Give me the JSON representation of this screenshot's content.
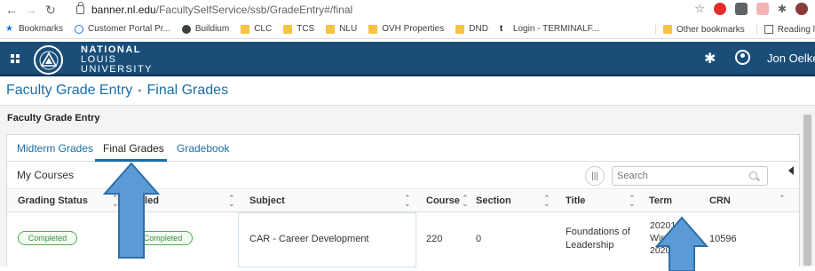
{
  "browser": {
    "url_host": "banner.nl.edu",
    "url_path": "/FacultySelfService/ssb/GradeEntry#/final",
    "bookmarks": [
      "Bookmarks",
      "Customer Portal Pr...",
      "Buildium",
      "CLC",
      "TCS",
      "NLU",
      "OVH Properties",
      "DND",
      "Login - TERMINALF..."
    ],
    "bookmarks_right": [
      "Other bookmarks",
      "Reading l"
    ]
  },
  "header": {
    "logo_line1": "NATIONAL",
    "logo_line2": "LOUIS",
    "logo_line3": "UNIVERSITY",
    "user_name": "Jon Oelke"
  },
  "breadcrumb": {
    "parent": "Faculty Grade Entry",
    "separator": "•",
    "current": "Final Grades"
  },
  "page": {
    "section_title": "Faculty Grade Entry",
    "tabs": [
      {
        "label": "Midterm Grades",
        "active": false
      },
      {
        "label": "Final Grades",
        "active": true
      },
      {
        "label": "Gradebook",
        "active": false
      }
    ],
    "courses_label": "My Courses",
    "search_placeholder": "Search"
  },
  "table": {
    "columns": [
      "Grading Status",
      "lled",
      "Subject",
      "Course",
      "Section",
      "Title",
      "Term",
      "CRN"
    ],
    "rows": [
      {
        "grading_status": "Completed",
        "rolled": "Completed",
        "subject": "CAR - Career Development",
        "course": "220",
        "section": "0",
        "title_line1": "Foundations of",
        "title_line2": "Leadership",
        "term_line1": "202010",
        "term_line2": "Winter",
        "term_line3": "2020",
        "crn": "10596"
      }
    ]
  },
  "colors": {
    "header_bg": "#1a4e79",
    "link": "#1a6ea8",
    "completed": "#4caf50",
    "annotation_arrow": "#5b9bd5"
  }
}
